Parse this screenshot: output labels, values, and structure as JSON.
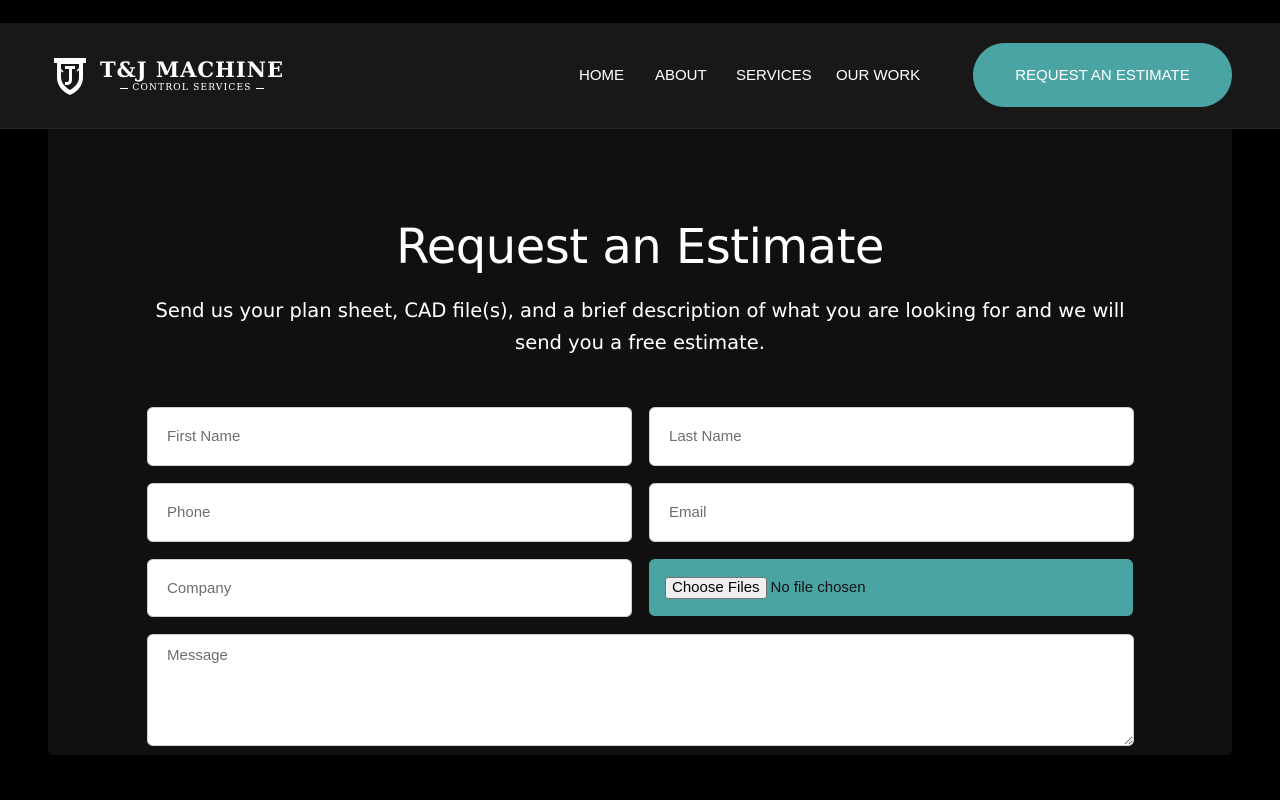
{
  "header": {
    "logo": {
      "title": "T&J MACHINE",
      "subtitle": "CONTROL SERVICES"
    },
    "nav": [
      {
        "label": "HOME"
      },
      {
        "label": "ABOUT"
      },
      {
        "label": "SERVICES"
      },
      {
        "label": "OUR WORK"
      }
    ],
    "cta_label": "REQUEST AN ESTIMATE"
  },
  "main": {
    "title": "Request an Estimate",
    "description": "Send us your plan sheet, CAD file(s), and a brief description of what you are looking for and we will send you a free estimate."
  },
  "form": {
    "first_name": {
      "placeholder": "First Name",
      "value": ""
    },
    "last_name": {
      "placeholder": "Last Name",
      "value": ""
    },
    "phone": {
      "placeholder": "Phone",
      "value": ""
    },
    "email": {
      "placeholder": "Email",
      "value": ""
    },
    "company": {
      "placeholder": "Company",
      "value": ""
    },
    "files": {
      "button_label": "Choose Files",
      "status": "No file chosen"
    },
    "message": {
      "placeholder": "Message",
      "value": ""
    }
  },
  "colors": {
    "accent": "#4aa4a3",
    "header_bg": "#181818",
    "panel_bg": "#101010",
    "page_bg": "#000000"
  },
  "icons": [
    "shield-logo-icon"
  ]
}
